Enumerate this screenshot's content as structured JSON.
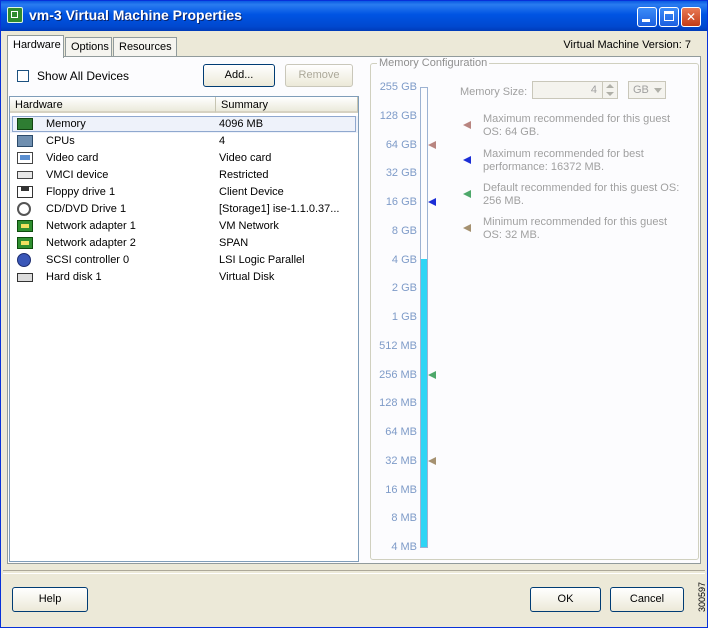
{
  "window": {
    "title": "vm-3 Virtual Machine Properties",
    "version_label": "Virtual Machine Version: 7"
  },
  "tabs": [
    {
      "label": "Hardware",
      "active": true
    },
    {
      "label": "Options",
      "active": false
    },
    {
      "label": "Resources",
      "active": false
    }
  ],
  "hardware_panel": {
    "show_all_devices_label": "Show All Devices",
    "show_all_devices_checked": false,
    "add_button": "Add...",
    "remove_button": "Remove",
    "columns": [
      "Hardware",
      "Summary"
    ],
    "devices": [
      {
        "name": "Memory",
        "summary": "4096 MB",
        "icon": "memory-icon"
      },
      {
        "name": "CPUs",
        "summary": "4",
        "icon": "cpu-icon"
      },
      {
        "name": "Video card",
        "summary": "Video card",
        "icon": "video-card-icon"
      },
      {
        "name": "VMCI device",
        "summary": "Restricted",
        "icon": "vmci-device-icon"
      },
      {
        "name": "Floppy drive 1",
        "summary": "Client Device",
        "icon": "floppy-drive-icon"
      },
      {
        "name": "CD/DVD Drive 1",
        "summary": "[Storage1] ise-1.1.0.37...",
        "icon": "cd-dvd-drive-icon"
      },
      {
        "name": "Network adapter 1",
        "summary": "VM Network",
        "icon": "network-adapter-icon"
      },
      {
        "name": "Network adapter 2",
        "summary": "SPAN",
        "icon": "network-adapter-icon"
      },
      {
        "name": "SCSI controller 0",
        "summary": "LSI Logic Parallel",
        "icon": "scsi-controller-icon"
      },
      {
        "name": "Hard disk 1",
        "summary": "Virtual Disk",
        "icon": "hard-disk-icon"
      }
    ],
    "selected_index": 0
  },
  "memory_config": {
    "title": "Memory Configuration",
    "memory_size_label": "Memory Size:",
    "memory_size_value": "4",
    "memory_unit": "GB",
    "scale_labels": [
      "255 GB",
      "128 GB",
      "64 GB",
      "32 GB",
      "16 GB",
      "8 GB",
      "4 GB",
      "2 GB",
      "1 GB",
      "512 MB",
      "256 MB",
      "128 MB",
      "64 MB",
      "32 MB",
      "16 MB",
      "8 MB",
      "4 MB"
    ],
    "current_level_label": "4 GB",
    "markers": [
      {
        "level_label": "64 GB",
        "color": "#b88580"
      },
      {
        "level_label": "16 GB",
        "color": "#1b2ed6"
      },
      {
        "level_label": "256 MB",
        "color": "#4ea86a"
      },
      {
        "level_label": "32 MB",
        "color": "#a59170"
      }
    ],
    "legend": [
      {
        "text": "Maximum recommended for this guest OS: 64 GB.",
        "color": "#b88580"
      },
      {
        "text": "Maximum recommended for best performance: 16372 MB.",
        "color": "#1b2ed6"
      },
      {
        "text": "Default recommended for this guest OS: 256 MB.",
        "color": "#4ea86a"
      },
      {
        "text": "Minimum recommended for this guest OS: 32 MB.",
        "color": "#a59170"
      }
    ],
    "fill_color": "#2dd5f5"
  },
  "footer": {
    "help_button": "Help",
    "ok_button": "OK",
    "cancel_button": "Cancel"
  },
  "figure_id": "300597"
}
